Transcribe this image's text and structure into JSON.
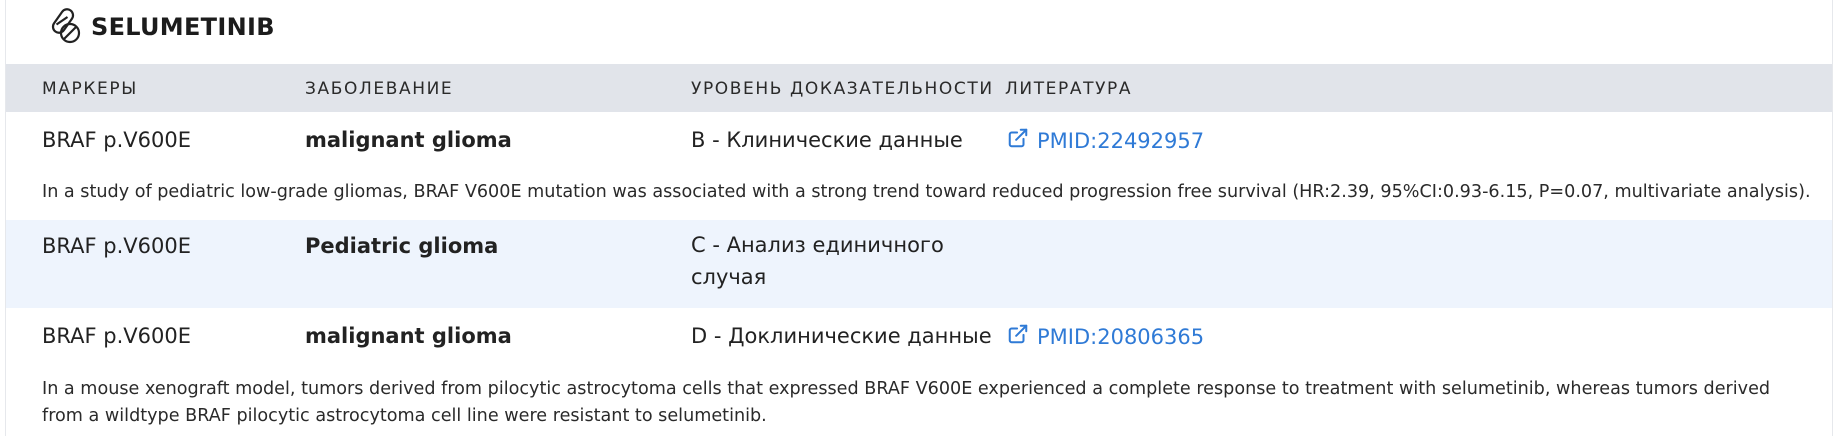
{
  "drug": {
    "name": "SELUMETINIB",
    "icon": "pills-icon"
  },
  "table": {
    "headers": {
      "markers": "МАРКЕРЫ",
      "disease": "ЗАБОЛЕВАНИЕ",
      "evidence": "УРОВЕНЬ ДОКАЗАТЕЛЬНОСТИ",
      "literature": "ЛИТЕРАТУРА"
    },
    "rows": [
      {
        "marker": "BRAF p.V600E",
        "disease": "malignant glioma",
        "evidence": "B - Клинические данные",
        "literature": "PMID:22492957",
        "note": "In a study of pediatric low-grade gliomas, BRAF V600E mutation was associated with a strong trend toward reduced progression free survival (HR:2.39, 95%CI:0.93-6.15, P=0.07, multivariate analysis)."
      },
      {
        "marker": "BRAF p.V600E",
        "disease": "Pediatric glioma",
        "evidence": "C - Анализ единичного случая",
        "literature": "",
        "note": ""
      },
      {
        "marker": "BRAF p.V600E",
        "disease": "malignant glioma",
        "evidence": "D - Доклинические данные",
        "literature": "PMID:20806365",
        "note": "In a mouse xenograft model, tumors derived from pilocytic astrocytoma cells that expressed BRAF V600E experienced a complete response to treatment with selumetinib, whereas tumors derived from a wildtype BRAF pilocytic astrocytoma cell line were resistant to selumetinib."
      }
    ]
  },
  "colors": {
    "header_bg": "#e1e4ea",
    "alt_row_bg": "#eef4fd",
    "link": "#2f7ad6"
  }
}
